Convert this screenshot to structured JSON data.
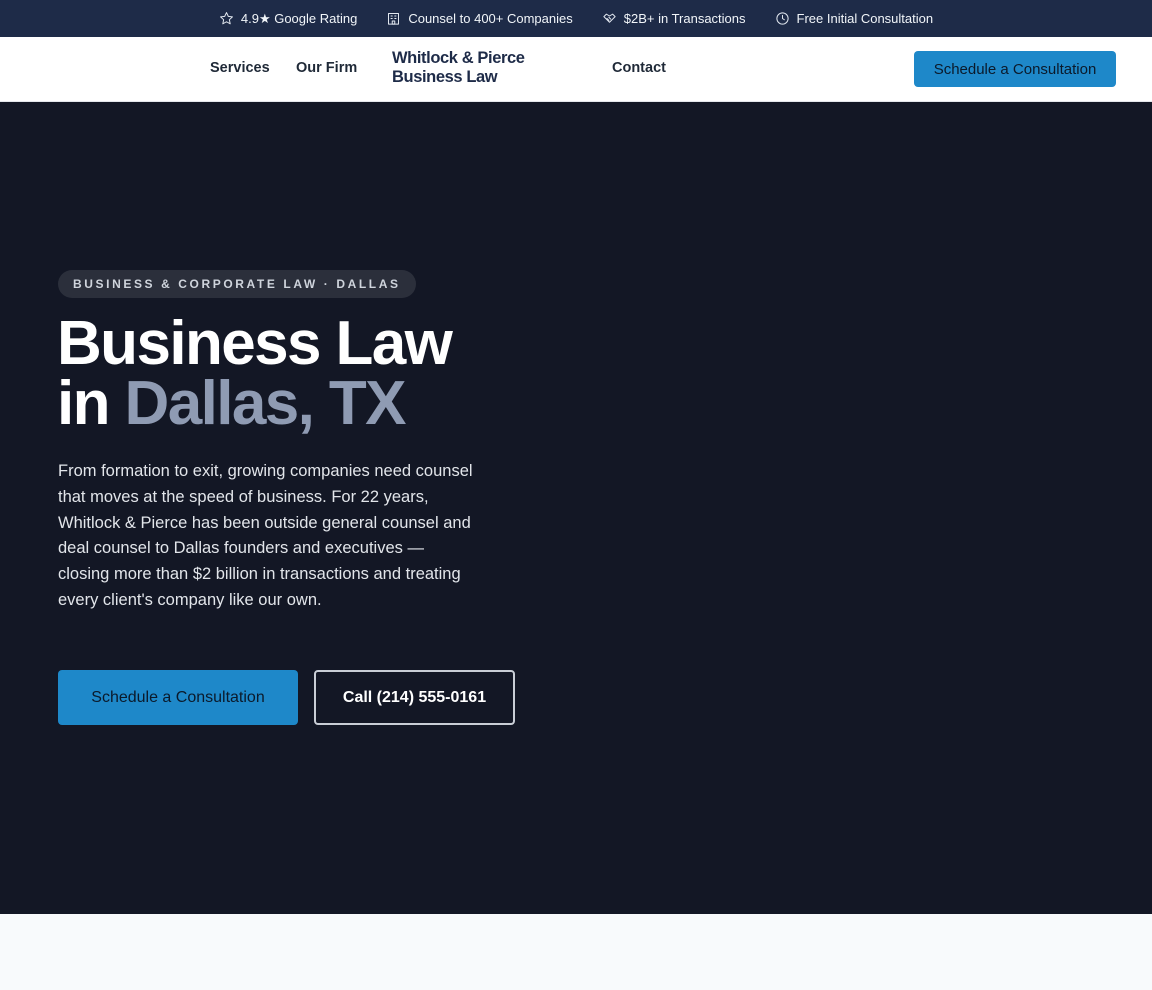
{
  "topbar": {
    "items": [
      {
        "icon": "star-icon",
        "label": "4.9★ Google Rating"
      },
      {
        "icon": "building-icon",
        "label": "Counsel to 400+ Companies"
      },
      {
        "icon": "handshake-icon",
        "label": "$2B+ in Transactions"
      },
      {
        "icon": "clock-icon",
        "label": "Free Initial Consultation"
      }
    ]
  },
  "nav": {
    "links": [
      "Services",
      "Our Firm",
      "Contact"
    ],
    "brand": {
      "line1": "Whitlock & Pierce",
      "line2": "Business Law"
    },
    "cta": "Schedule a Consultation"
  },
  "hero": {
    "badge": "BUSINESS & CORPORATE LAW · DALLAS",
    "headline_line1": "Business Law",
    "headline_in": "in",
    "headline_accent": "Dallas, TX",
    "lede": "From formation to exit, growing companies need counsel that moves at the speed of business. For 22 years, Whitlock & Pierce has been outside general counsel and deal counsel to Dallas founders and executives — closing more than $2 billion in transactions and treating every client's company like our own.",
    "primary_cta": "Schedule a Consultation",
    "secondary_cta": "Call (214) 555-0161"
  },
  "colors": {
    "topbar_bg": "#1e2b48",
    "hero_bg": "#131725",
    "accent_blue": "#1e88c9",
    "headline_accent": "#8f9bb3"
  }
}
